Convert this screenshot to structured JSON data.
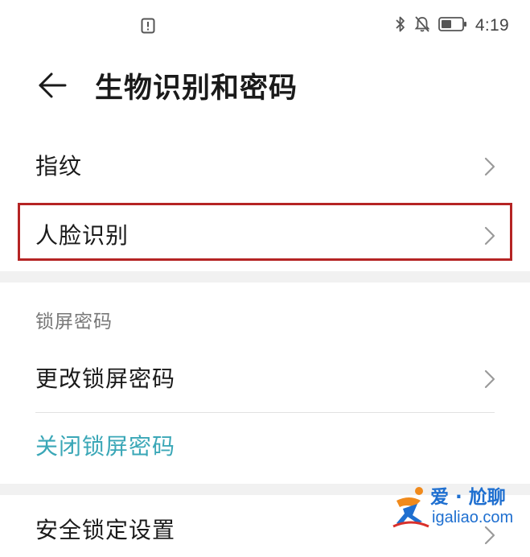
{
  "status_bar": {
    "time": "4:19",
    "left_icon": "notification-alert-icon",
    "right_icons": [
      "bluetooth-icon",
      "silent-mode-icon",
      "battery-icon"
    ]
  },
  "header": {
    "back_icon": "back-arrow-icon",
    "title": "生物识别和密码"
  },
  "biometrics": {
    "items": [
      {
        "label": "指纹",
        "icon": "chevron-right-icon"
      },
      {
        "label": "人脸识别",
        "icon": "chevron-right-icon",
        "highlighted": true
      }
    ],
    "highlight_color": "#b52424"
  },
  "lock_screen": {
    "section_title": "锁屏密码",
    "items": [
      {
        "label": "更改锁屏密码",
        "icon": "chevron-right-icon"
      },
      {
        "label": "关闭锁屏密码",
        "accent_color": "#3aa7b7"
      }
    ]
  },
  "security": {
    "items": [
      {
        "label": "安全锁定设置",
        "icon": "chevron-right-icon"
      }
    ]
  },
  "watermark": {
    "line1": "爱 · 尬聊",
    "line2": "igaliao.com",
    "color": "#1e6fd0"
  }
}
